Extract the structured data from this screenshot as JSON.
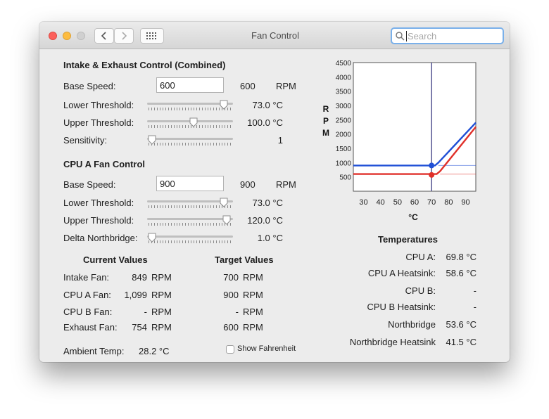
{
  "window": {
    "title": "Fan Control"
  },
  "search": {
    "placeholder": "Search"
  },
  "intake": {
    "heading": "Intake & Exhaust Control (Combined)",
    "base_label": "Base Speed:",
    "base_value": "600",
    "base_readout": "600",
    "base_unit": "RPM",
    "lower_label": "Lower Threshold:",
    "lower_value": "73.0 °C",
    "lower_level": 0.94,
    "upper_label": "Upper Threshold:",
    "upper_value": "100.0 °C",
    "upper_level": 0.55,
    "sens_label": "Sensitivity:",
    "sens_value": "1",
    "sens_level": 0.0
  },
  "cpua": {
    "heading": "CPU A Fan Control",
    "base_label": "Base Speed:",
    "base_value": "900",
    "base_readout": "900",
    "base_unit": "RPM",
    "lower_label": "Lower Threshold:",
    "lower_value": "73.0 °C",
    "lower_level": 0.94,
    "upper_label": "Upper Threshold:",
    "upper_value": "120.0 °C",
    "upper_level": 0.98,
    "delta_label": "Delta Northbridge:",
    "delta_value": "1.0 °C",
    "delta_level": 0.0
  },
  "current": {
    "heading": "Current Values",
    "rows": [
      {
        "label": "Intake Fan:",
        "value": "849",
        "unit": "RPM"
      },
      {
        "label": "CPU A Fan:",
        "value": "1,099",
        "unit": "RPM"
      },
      {
        "label": "CPU B Fan:",
        "value": "-",
        "unit": "RPM"
      },
      {
        "label": "Exhaust Fan:",
        "value": "754",
        "unit": "RPM"
      }
    ]
  },
  "target": {
    "heading": "Target Values",
    "rows": [
      {
        "value": "700",
        "unit": "RPM"
      },
      {
        "value": "900",
        "unit": "RPM"
      },
      {
        "value": "-",
        "unit": "RPM"
      },
      {
        "value": "600",
        "unit": "RPM"
      }
    ]
  },
  "ambient": {
    "label": "Ambient Temp:",
    "value": "28.2 °C"
  },
  "fahrenheit": {
    "label": "Show Fahrenheit",
    "checked": false
  },
  "temps": {
    "heading": "Temperatures",
    "rows": [
      {
        "label": "CPU A:",
        "value": "69.8 °C"
      },
      {
        "label": "CPU A Heatsink:",
        "value": "58.6 °C"
      },
      {
        "label": "CPU B:",
        "value": "-"
      },
      {
        "label": "CPU B Heatsink:",
        "value": "-"
      },
      {
        "label": "Northbridge",
        "value": "53.6 °C"
      },
      {
        "label": "Northbridge Heatsink",
        "value": "41.5 °C"
      }
    ]
  },
  "colors": {
    "blue": "#1f4fd6",
    "red": "#e0302a",
    "cursor_line": "#4a4a8a"
  },
  "chart_data": {
    "type": "line",
    "xlabel": "°C",
    "ylabel": [
      "R",
      "P",
      "M"
    ],
    "xlim": [
      24,
      96
    ],
    "ylim": [
      0,
      4500
    ],
    "x_ticks": [
      "30",
      "40",
      "50",
      "60",
      "70",
      "80",
      "90"
    ],
    "x_tick_values": [
      30,
      40,
      50,
      60,
      70,
      80,
      90
    ],
    "y_ticks": [
      "500",
      "1000",
      "1500",
      "2000",
      "2500",
      "3000",
      "3500",
      "4000",
      "4500"
    ],
    "y_tick_values": [
      500,
      1000,
      1500,
      2000,
      2500,
      3000,
      3500,
      4000,
      4500
    ],
    "current_temp": 70,
    "series": [
      {
        "color": "blue",
        "points": [
          [
            24,
            900
          ],
          [
            72,
            900
          ],
          [
            74,
            1000
          ],
          [
            96,
            2400
          ]
        ],
        "base_extension": [
          [
            74,
            900
          ],
          [
            96,
            900
          ]
        ],
        "marker": [
          70,
          900
        ]
      },
      {
        "color": "red",
        "points": [
          [
            24,
            600
          ],
          [
            73,
            600
          ],
          [
            75,
            700
          ],
          [
            96,
            2250
          ]
        ],
        "base_extension": [
          [
            75,
            600
          ],
          [
            96,
            600
          ]
        ],
        "marker": [
          70,
          570
        ]
      }
    ]
  }
}
